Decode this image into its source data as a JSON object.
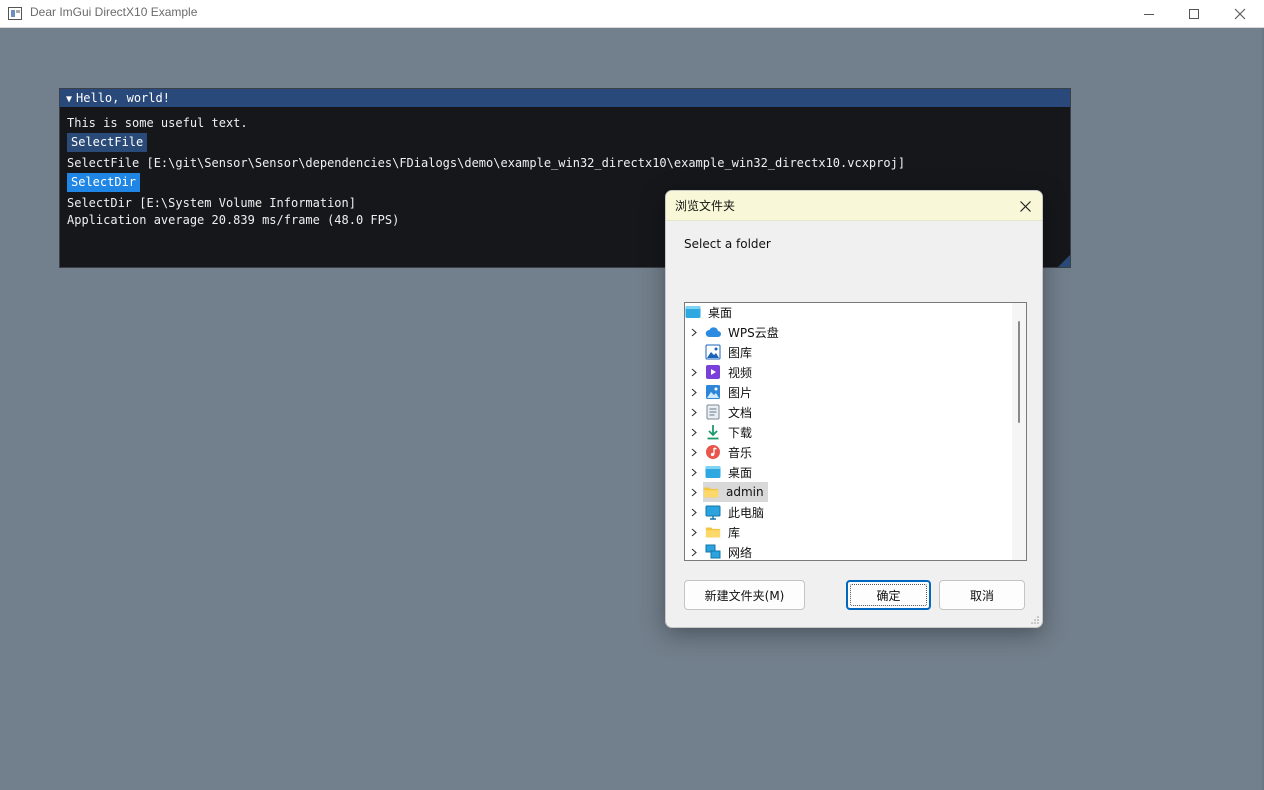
{
  "window": {
    "title": "Dear ImGui DirectX10 Example",
    "min_glyph": "minimize-icon",
    "max_glyph": "maximize-icon",
    "close_glyph": "close-icon"
  },
  "imgui": {
    "title": "Hello, world!",
    "text": "This is some useful text.",
    "select_file_button": "SelectFile",
    "select_file_result": "SelectFile [E:\\git\\Sensor\\Sensor\\dependencies\\FDialogs\\demo\\example_win32_directx10\\example_win32_directx10.vcxproj]",
    "select_dir_button": "SelectDir",
    "select_dir_result": "SelectDir [E:\\System Volume Information]",
    "fps_text": "Application average 20.839 ms/frame (48.0 FPS)"
  },
  "dialog": {
    "title": "浏览文件夹",
    "prompt": "Select a folder",
    "tree": [
      {
        "label": "桌面",
        "icon": "desktop-icon",
        "expandable": false,
        "level": 0
      },
      {
        "label": "WPS云盘",
        "icon": "cloud-icon",
        "expandable": true,
        "level": 1
      },
      {
        "label": "图库",
        "icon": "gallery-icon",
        "expandable": false,
        "level": 1
      },
      {
        "label": "视频",
        "icon": "video-icon",
        "expandable": true,
        "level": 1
      },
      {
        "label": "图片",
        "icon": "pictures-icon",
        "expandable": true,
        "level": 1
      },
      {
        "label": "文档",
        "icon": "documents-icon",
        "expandable": true,
        "level": 1
      },
      {
        "label": "下载",
        "icon": "download-icon",
        "expandable": true,
        "level": 1
      },
      {
        "label": "音乐",
        "icon": "music-icon",
        "expandable": true,
        "level": 1
      },
      {
        "label": "桌面",
        "icon": "desktop-icon",
        "expandable": true,
        "level": 1
      },
      {
        "label": "admin",
        "icon": "folder-icon",
        "expandable": true,
        "level": 1,
        "selected": true
      },
      {
        "label": "此电脑",
        "icon": "computer-icon",
        "expandable": true,
        "level": 1
      },
      {
        "label": "库",
        "icon": "library-folder-icon",
        "expandable": true,
        "level": 1
      },
      {
        "label": "网络",
        "icon": "network-icon",
        "expandable": true,
        "level": 1
      }
    ],
    "new_folder_button": "新建文件夹(M)",
    "ok_button": "确定",
    "cancel_button": "取消"
  },
  "colors": {
    "background": "#727f8c",
    "imgui_title": "#29497a",
    "imgui_body": "#15171b",
    "select_dir_button": "#1f86e6",
    "dialog_titlebar": "#f8f8d8",
    "accent": "#0067c0"
  }
}
